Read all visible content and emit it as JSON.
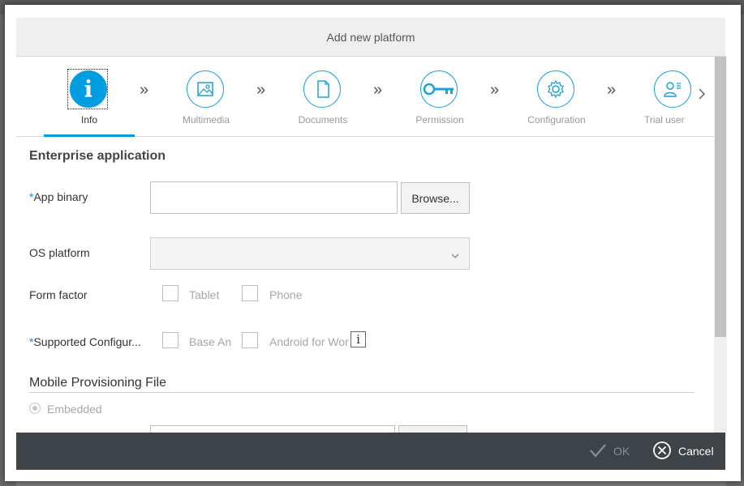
{
  "dialog": {
    "title": "Add new platform"
  },
  "steps": [
    {
      "label": "Info",
      "icon": "info-icon",
      "active": true
    },
    {
      "label": "Multimedia",
      "icon": "image-icon"
    },
    {
      "label": "Documents",
      "icon": "document-icon"
    },
    {
      "label": "Permission",
      "icon": "key-icon"
    },
    {
      "label": "Configuration",
      "icon": "gear-icon"
    },
    {
      "label": "Trial user",
      "icon": "user-list-icon"
    }
  ],
  "form": {
    "section_title": "Enterprise application",
    "required_marker": "*",
    "app_binary": {
      "label": "App binary",
      "value": "",
      "browse_label": "Browse..."
    },
    "os_platform": {
      "label": "OS platform",
      "value": ""
    },
    "form_factor": {
      "label": "Form factor",
      "options": [
        "Tablet",
        "Phone"
      ]
    },
    "supported_config": {
      "label": "Supported Configur...",
      "options": [
        "Base An",
        "Android for Wor"
      ],
      "info": "i"
    },
    "provisioning": {
      "title": "Mobile Provisioning File",
      "radio_label": "Embedded"
    }
  },
  "footer": {
    "ok_label": "OK",
    "cancel_label": "Cancel"
  },
  "colors": {
    "accent": "#009de0",
    "footer": "#3d4347",
    "header": "#efefef"
  }
}
